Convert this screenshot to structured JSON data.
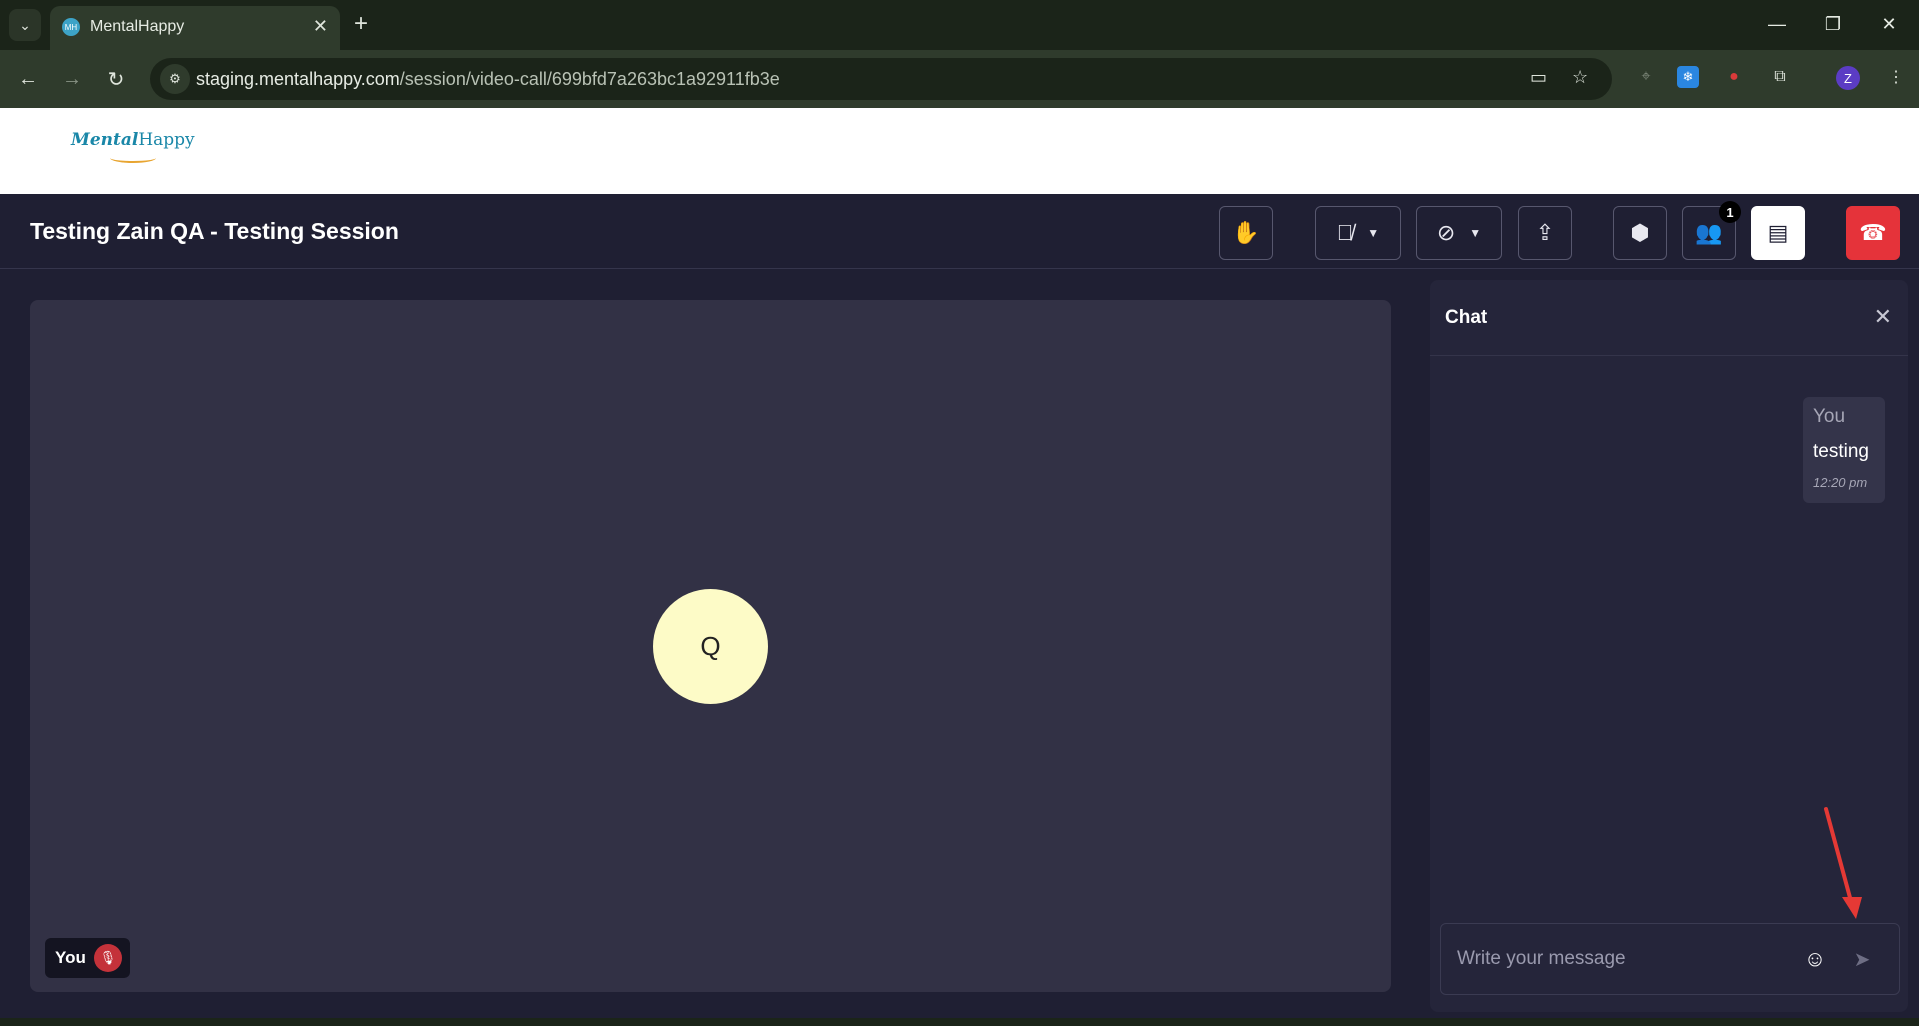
{
  "browser": {
    "tab_title": "MentalHappy",
    "favicon_text": "MH",
    "url_host": "staging.mentalhappy.com",
    "url_path": "/session/video-call/699bfd7a263bc1a92911fb3e",
    "profile_initial": "Z"
  },
  "header": {
    "logo_primary": "Mental",
    "logo_secondary": "Happy"
  },
  "session": {
    "title": "Testing Zain QA - Testing Session",
    "participants_badge": "1"
  },
  "video": {
    "avatar_initial": "Q",
    "self_label": "You"
  },
  "chat": {
    "title": "Chat",
    "messages": [
      {
        "sender": "You",
        "text": "testing",
        "time": "12:20 pm"
      }
    ],
    "input_placeholder": "Write your message"
  },
  "colors": {
    "accent_end_call": "#e5333a",
    "avatar_bg": "#fdfbc7",
    "annotation_arrow": "#e53935"
  }
}
